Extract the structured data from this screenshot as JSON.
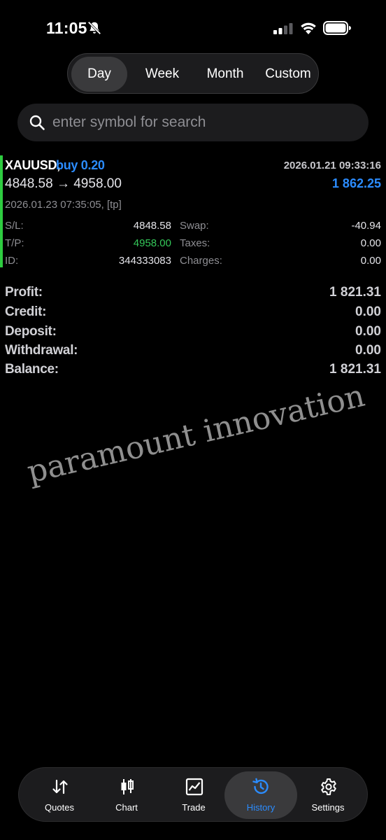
{
  "status": {
    "time": "11:05"
  },
  "period_tabs": {
    "day": "Day",
    "week": "Week",
    "month": "Month",
    "custom": "Custom",
    "selected": "Day"
  },
  "search": {
    "placeholder": "enter symbol for search"
  },
  "deal": {
    "symbol": "XAUUSD,",
    "side": "buy 0.20",
    "open_time": "2026.01.21 09:33:16",
    "prices": "4848.58 → 4958.00",
    "profit": "1 862.25",
    "close_info": "2026.01.23 07:35:05, [tp]",
    "sl_label": "S/L:",
    "sl": "4848.58",
    "tp_label": "T/P:",
    "tp": "4958.00",
    "id_label": "ID:",
    "id": "344333083",
    "swap_label": "Swap:",
    "swap": "-40.94",
    "taxes_label": "Taxes:",
    "taxes": "0.00",
    "charges_label": "Charges:",
    "charges": "0.00"
  },
  "summary": {
    "profit_label": "Profit:",
    "profit": "1 821.31",
    "credit_label": "Credit:",
    "credit": "0.00",
    "deposit_label": "Deposit:",
    "deposit": "0.00",
    "withdrawal_label": "Withdrawal:",
    "withdrawal": "0.00",
    "balance_label": "Balance:",
    "balance": "1 821.31"
  },
  "watermark": "paramount innovation",
  "tabbar": {
    "quotes": "Quotes",
    "chart": "Chart",
    "trade": "Trade",
    "history": "History",
    "settings": "Settings",
    "active": "History"
  },
  "colors": {
    "accent_blue": "#2b8cff",
    "tp_green": "#34c759",
    "deal_accent": "#2ecc40",
    "background": "#000000"
  }
}
